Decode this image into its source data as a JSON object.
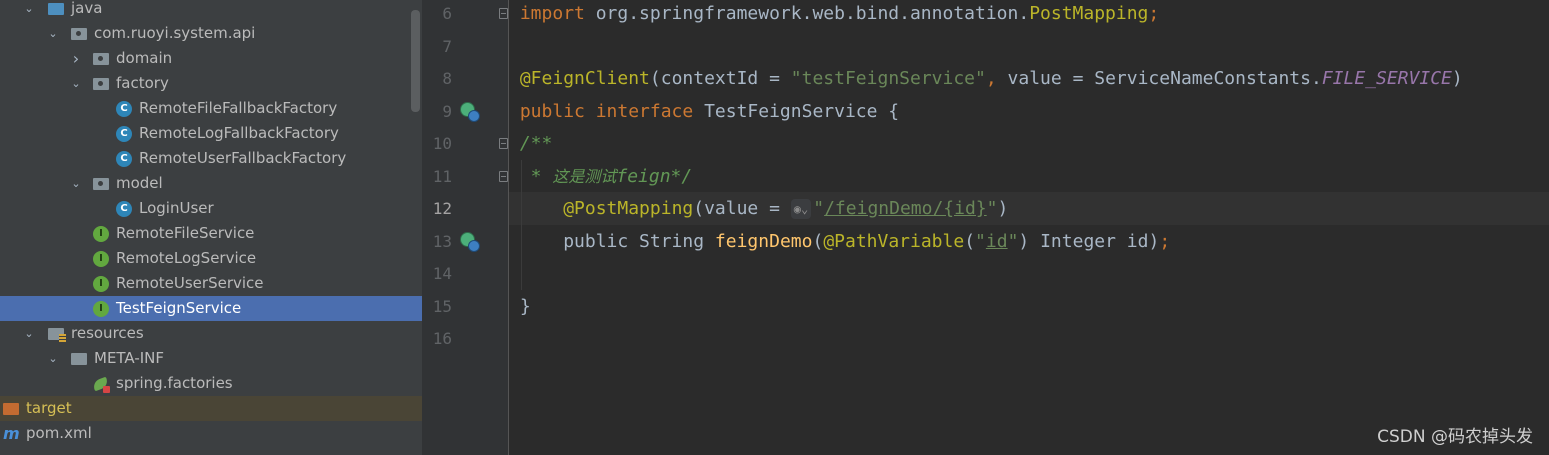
{
  "project_tree": {
    "items": [
      {
        "label": "java",
        "expanded": true,
        "icon": "source-folder-icon",
        "kind": "folder-blue",
        "level": 0
      },
      {
        "label": "com.ruoyi.system.api",
        "expanded": true,
        "icon": "package-icon",
        "kind": "package",
        "level": 1
      },
      {
        "label": "domain",
        "expanded": false,
        "icon": "package-icon",
        "kind": "package",
        "level": 2
      },
      {
        "label": "factory",
        "expanded": true,
        "icon": "package-icon",
        "kind": "package",
        "level": 2
      },
      {
        "label": "RemoteFileFallbackFactory",
        "icon": "class-icon",
        "kind": "class",
        "level": 3
      },
      {
        "label": "RemoteLogFallbackFactory",
        "icon": "class-icon",
        "kind": "class",
        "level": 3
      },
      {
        "label": "RemoteUserFallbackFactory",
        "icon": "class-icon",
        "kind": "class",
        "level": 3
      },
      {
        "label": "model",
        "expanded": true,
        "icon": "package-icon",
        "kind": "package",
        "level": 2
      },
      {
        "label": "LoginUser",
        "icon": "class-icon",
        "kind": "class",
        "level": 3
      },
      {
        "label": "RemoteFileService",
        "icon": "interface-icon",
        "kind": "interface",
        "level": 2
      },
      {
        "label": "RemoteLogService",
        "icon": "interface-icon",
        "kind": "interface",
        "level": 2
      },
      {
        "label": "RemoteUserService",
        "icon": "interface-icon",
        "kind": "interface",
        "level": 2
      },
      {
        "label": "TestFeignService",
        "icon": "interface-icon",
        "kind": "interface",
        "level": 2,
        "selected": true
      },
      {
        "label": "resources",
        "expanded": true,
        "icon": "resources-folder-icon",
        "kind": "resources",
        "level": 0
      },
      {
        "label": "META-INF",
        "expanded": true,
        "icon": "folder-icon",
        "kind": "folder",
        "level": 1
      },
      {
        "label": "spring.factories",
        "icon": "spring-icon",
        "kind": "spring",
        "level": 2
      },
      {
        "label": "target",
        "icon": "excluded-folder-icon",
        "kind": "excluded",
        "level": -1
      },
      {
        "label": "pom.xml",
        "icon": "maven-icon",
        "kind": "maven",
        "level": -1
      }
    ]
  },
  "editor": {
    "current_line": "12",
    "lines": [
      {
        "num": "6",
        "tokens": [
          {
            "c": "kw",
            "t": "import "
          },
          {
            "c": "txt",
            "t": "org.springframework.web.bind.annotation."
          },
          {
            "c": "ann",
            "t": "PostMapping"
          },
          {
            "c": "kw",
            "t": ";"
          }
        ]
      },
      {
        "num": "7",
        "tokens": []
      },
      {
        "num": "8",
        "tokens": [
          {
            "c": "ann",
            "t": "@FeignClient"
          },
          {
            "c": "txt",
            "t": "(contextId = "
          },
          {
            "c": "str",
            "t": "\"testFeignService\""
          },
          {
            "c": "kw",
            "t": ", "
          },
          {
            "c": "txt",
            "t": "value = ServiceNameConstants."
          },
          {
            "c": "fld",
            "t": "FILE_SERVICE"
          },
          {
            "c": "txt",
            "t": ")"
          }
        ]
      },
      {
        "num": "9",
        "tokens": [
          {
            "c": "kw",
            "t": "public interface "
          },
          {
            "c": "txt",
            "t": "TestFeignService {"
          }
        ]
      },
      {
        "num": "10",
        "tokens": [
          {
            "c": "cmt",
            "t": "/**"
          }
        ]
      },
      {
        "num": "11",
        "tokens": [
          {
            "c": "cmt",
            "t": " * "
          },
          {
            "c": "cmt-cn",
            "t": "这是测试"
          },
          {
            "c": "cmt",
            "t": "feign*/"
          }
        ]
      },
      {
        "num": "12",
        "tokens": [
          {
            "c": "txt",
            "t": "    "
          },
          {
            "c": "ann",
            "t": "@PostMapping"
          },
          {
            "c": "txt",
            "t": "(value = "
          },
          {
            "c": "hint",
            "t": "◉⌄"
          },
          {
            "c": "str",
            "t": "\""
          },
          {
            "c": "str-u",
            "t": "/feignDemo/{id}"
          },
          {
            "c": "str",
            "t": "\""
          },
          {
            "c": "txt",
            "t": ")"
          }
        ]
      },
      {
        "num": "13",
        "tokens": [
          {
            "c": "txt",
            "t": "    public String "
          },
          {
            "c": "mth",
            "t": "feignDemo"
          },
          {
            "c": "txt",
            "t": "("
          },
          {
            "c": "ann",
            "t": "@PathVariable"
          },
          {
            "c": "txt",
            "t": "("
          },
          {
            "c": "str",
            "t": "\""
          },
          {
            "c": "str-u",
            "t": "id"
          },
          {
            "c": "str",
            "t": "\""
          },
          {
            "c": "txt",
            "t": ") Integer id)"
          },
          {
            "c": "kw",
            "t": ";"
          }
        ]
      },
      {
        "num": "14",
        "tokens": []
      },
      {
        "num": "15",
        "tokens": [
          {
            "c": "txt",
            "t": "}"
          }
        ]
      },
      {
        "num": "16",
        "tokens": []
      }
    ],
    "gutter_icons": [
      {
        "line": "9",
        "name": "implementations-gutter-icon"
      },
      {
        "line": "13",
        "name": "web-endpoint-gutter-icon"
      }
    ]
  },
  "watermark": {
    "text": "CSDN @码农掉头发"
  },
  "colors": {
    "tree_bg": "#3c3f41",
    "editor_bg": "#2b2b2b",
    "selection": "#4b6eaf",
    "keyword": "#cc7832",
    "annotation": "#bbb529",
    "string": "#6a8759"
  }
}
